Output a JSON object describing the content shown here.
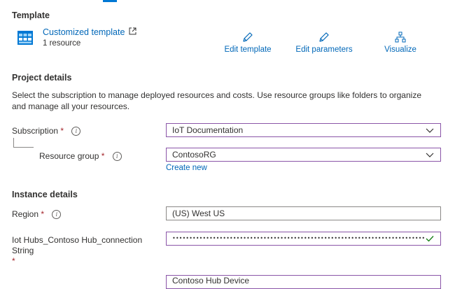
{
  "template": {
    "section_title": "Template",
    "name": "Customized template",
    "resource_count": "1 resource",
    "actions": {
      "edit_template": "Edit template",
      "edit_parameters": "Edit parameters",
      "visualize": "Visualize"
    }
  },
  "project": {
    "section_title": "Project details",
    "description": "Select the subscription to manage deployed resources and costs. Use resource groups like folders to organize and manage all your resources.",
    "subscription_label": "Subscription",
    "subscription_value": "IoT Documentation",
    "resource_group_label": "Resource group",
    "resource_group_value": "ContosoRG",
    "create_new": "Create new"
  },
  "instance": {
    "section_title": "Instance details",
    "region_label": "Region",
    "region_value": "(US) West US",
    "connection_label": "Iot Hubs_Contoso Hub_connection String",
    "connection_value": "•••••••••••••••••••••••••••••••••••••••••••••••••••••••••••••••••••••••••••••••••••••••••...",
    "next_value": "Contoso Hub Device"
  },
  "required_marker": "*",
  "colors": {
    "accent": "#0078d4",
    "link": "#0067b8",
    "field_border_active": "#8a55a8",
    "valid_check": "#107c10",
    "required": "#a4262c"
  }
}
